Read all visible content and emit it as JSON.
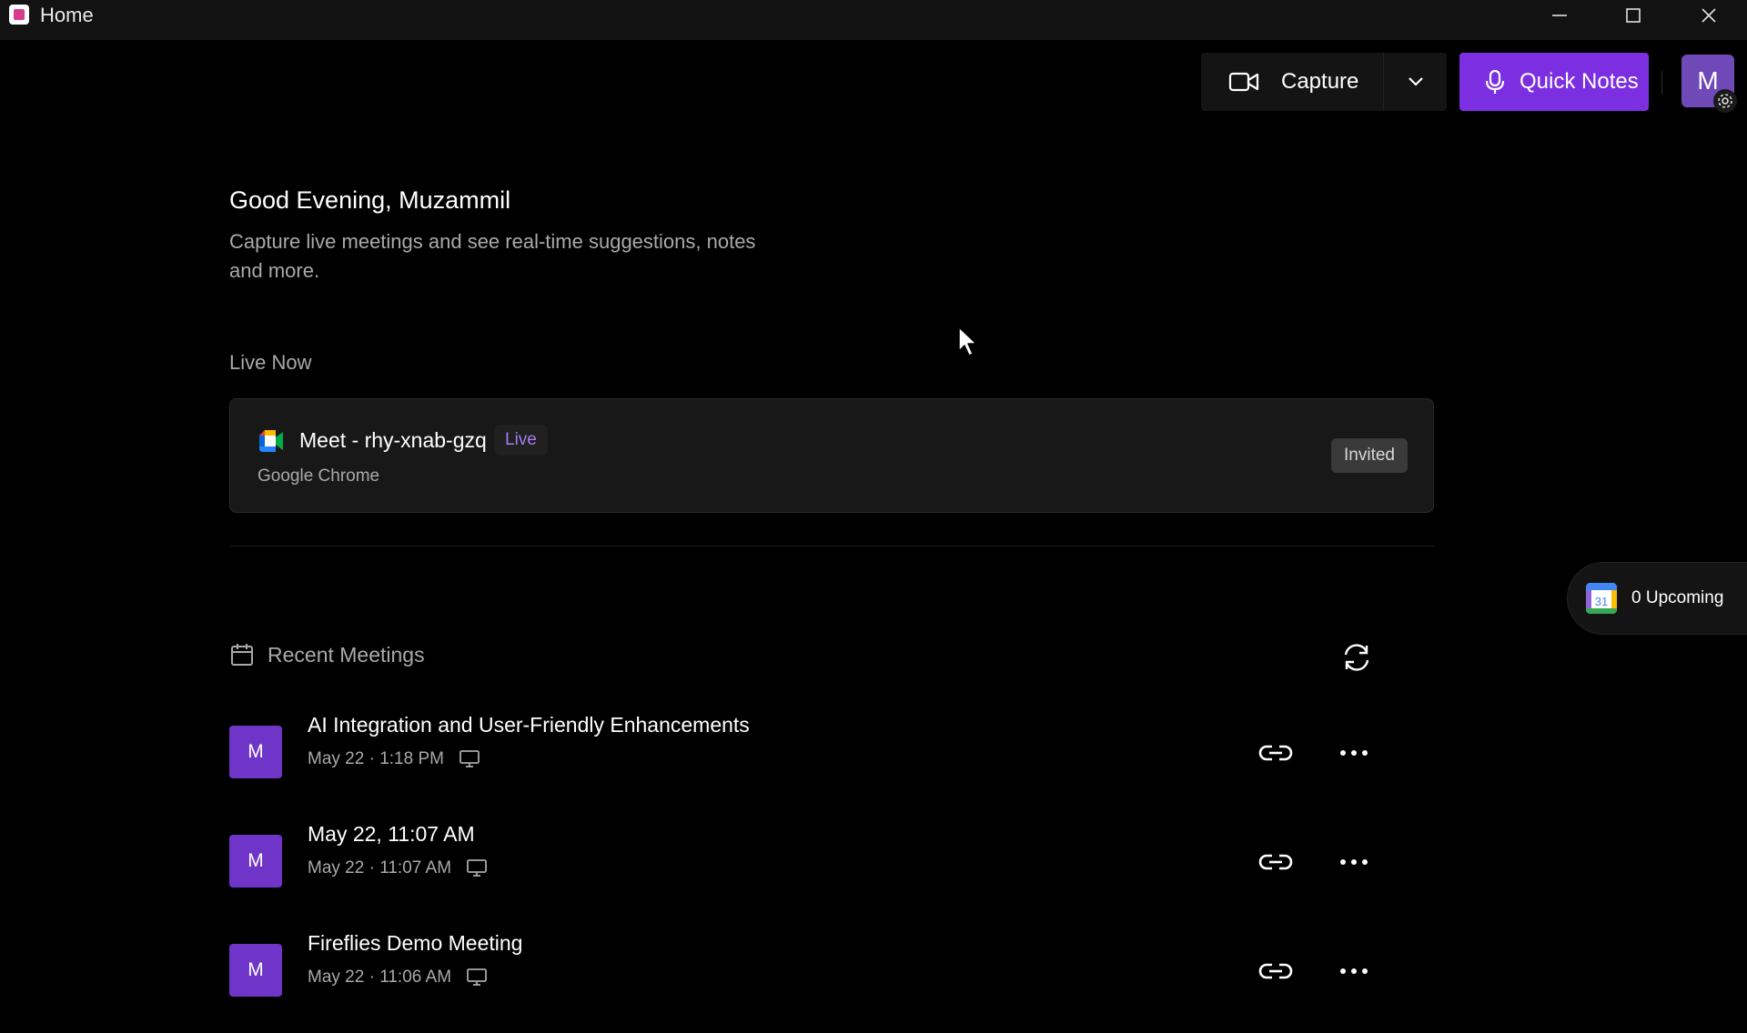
{
  "window": {
    "title": "Home"
  },
  "toolbar": {
    "capture_label": "Capture",
    "quick_notes_label": "Quick Notes",
    "avatar_initial": "M"
  },
  "greeting": {
    "title": "Good Evening, Muzammil",
    "subtitle": "Capture live meetings and see real-time suggestions, notes and more."
  },
  "live_now": {
    "heading": "Live Now",
    "meeting": {
      "title": "Meet - rhy-xnab-gzq",
      "badge": "Live",
      "source": "Google Chrome",
      "status": "Invited"
    }
  },
  "upcoming": {
    "label": "0 Upcoming",
    "calendar_number": "31"
  },
  "recent": {
    "heading": "Recent Meetings",
    "meetings": [
      {
        "avatar": "M",
        "title": "AI Integration and User-Friendly Enhancements",
        "time": "May 22 · 1:18 PM"
      },
      {
        "avatar": "M",
        "title": "May 22, 11:07 AM",
        "time": "May 22 · 11:07 AM"
      },
      {
        "avatar": "M",
        "title": "Fireflies Demo Meeting",
        "time": "May 22 · 11:06 AM"
      }
    ]
  },
  "colors": {
    "accent": "#7b2fe0",
    "avatar": "#6f35c8",
    "live_badge_text": "#a57cf0",
    "background": "#000000"
  },
  "icons": {
    "capture": "video-camera-icon",
    "quick_notes": "microphone-icon",
    "dropdown": "chevron-down-icon",
    "settings": "gear-icon",
    "calendar": "calendar-icon",
    "refresh": "refresh-icon",
    "link": "link-icon",
    "more": "more-horizontal-icon",
    "screen": "monitor-icon"
  }
}
